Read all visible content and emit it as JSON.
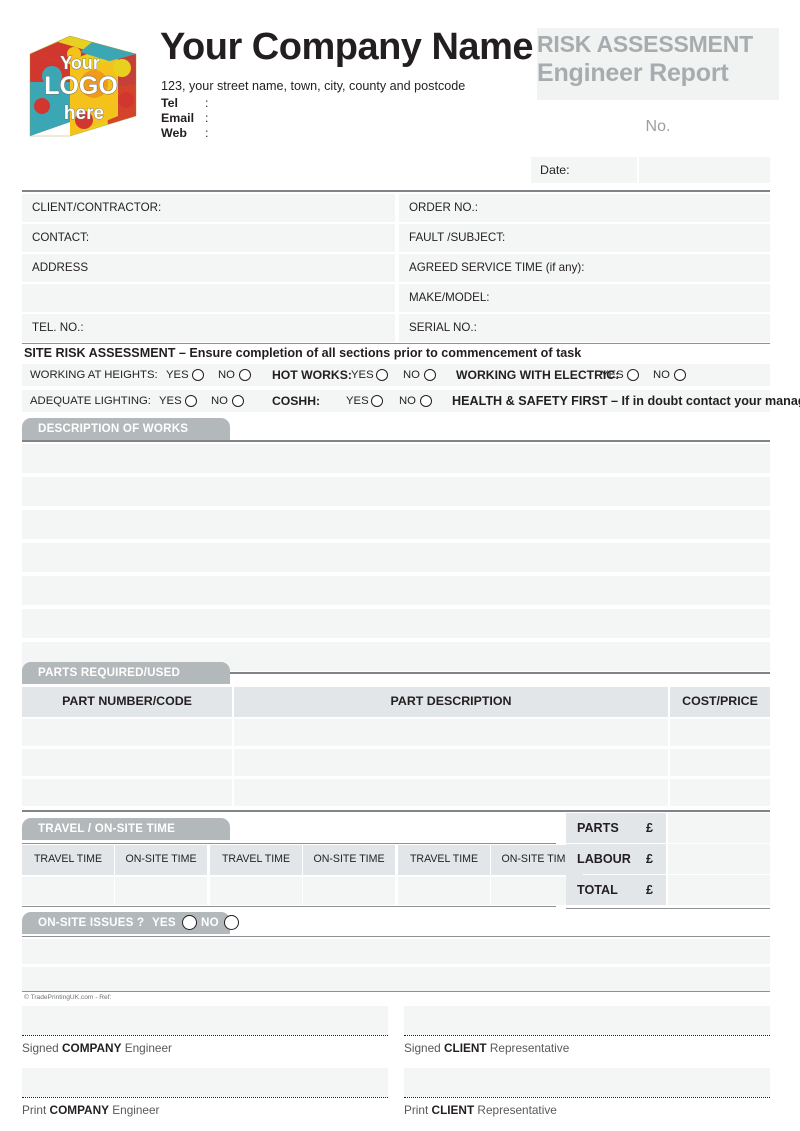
{
  "company": {
    "name": "Your Company Name",
    "address": "123, your street name, town, city, county and postcode",
    "tel_label": "Tel",
    "email_label": "Email",
    "web_label": "Web",
    "colon": ":"
  },
  "logo": {
    "line1": "Your",
    "line2": "LOGO",
    "line3": "here",
    "colors": {
      "red": "#d1372f",
      "teal": "#3ba7b5",
      "yellow": "#e8d01e",
      "orange": "#f09a1a",
      "gold": "#f5c21b"
    }
  },
  "header": {
    "title_line1": "RISK ASSESSMENT",
    "title_line2": "Engineer Report",
    "no_label": "No.",
    "date_label": "Date:"
  },
  "fields": {
    "left": [
      "CLIENT/CONTRACTOR:",
      "CONTACT:",
      "ADDRESS",
      "",
      "TEL. NO.:"
    ],
    "right": [
      "ORDER NO.:",
      "FAULT /SUBJECT:",
      "AGREED SERVICE TIME (if any):",
      "MAKE/MODEL:",
      "SERIAL NO.:"
    ]
  },
  "risk": {
    "heading": "SITE RISK ASSESSMENT – Ensure completion of all sections prior to commencement of task",
    "yes": "YES",
    "no": "NO",
    "row1": {
      "item1": "WORKING AT HEIGHTS:",
      "item2": "HOT WORKS:",
      "item3": "WORKING WITH ELECTRIC:"
    },
    "row2": {
      "item1": "ADEQUATE LIGHTING:",
      "item2": "COSHH:",
      "notice": "HEALTH & SAFETY FIRST – If in doubt contact your manager."
    }
  },
  "description": {
    "tab_label": "DESCRIPTION OF WORKS",
    "row_count": 7
  },
  "parts": {
    "tab_label": "PARTS REQUIRED/USED",
    "columns": [
      "PART NUMBER/CODE",
      "PART DESCRIPTION",
      "COST/PRICE"
    ],
    "row_count": 3
  },
  "travel": {
    "tab_label": "TRAVEL / ON-SITE TIME",
    "columns": [
      "TRAVEL TIME",
      "ON-SITE TIME",
      "TRAVEL TIME",
      "ON-SITE TIME",
      "TRAVEL TIME",
      "ON-SITE TIME"
    ]
  },
  "totals": {
    "currency": "£",
    "rows": [
      "PARTS",
      "LABOUR",
      "TOTAL"
    ]
  },
  "issues": {
    "tab_label": "ON-SITE ISSUES ?",
    "yes": "YES",
    "no": "NO",
    "row_count": 2
  },
  "footer": {
    "copyright": "© TradePrintingUK.com - Ref:",
    "sign_company_pre": "Signed ",
    "sign_company_bold": "COMPANY",
    "sign_company_post": " Engineer",
    "sign_client_pre": "Signed ",
    "sign_client_bold": "CLIENT",
    "sign_client_post": " Representative",
    "print_company_pre": "Print ",
    "print_company_bold": "COMPANY",
    "print_company_post": " Engineer",
    "print_client_pre": "Print ",
    "print_client_bold": "CLIENT",
    "print_client_post": " Representative"
  }
}
